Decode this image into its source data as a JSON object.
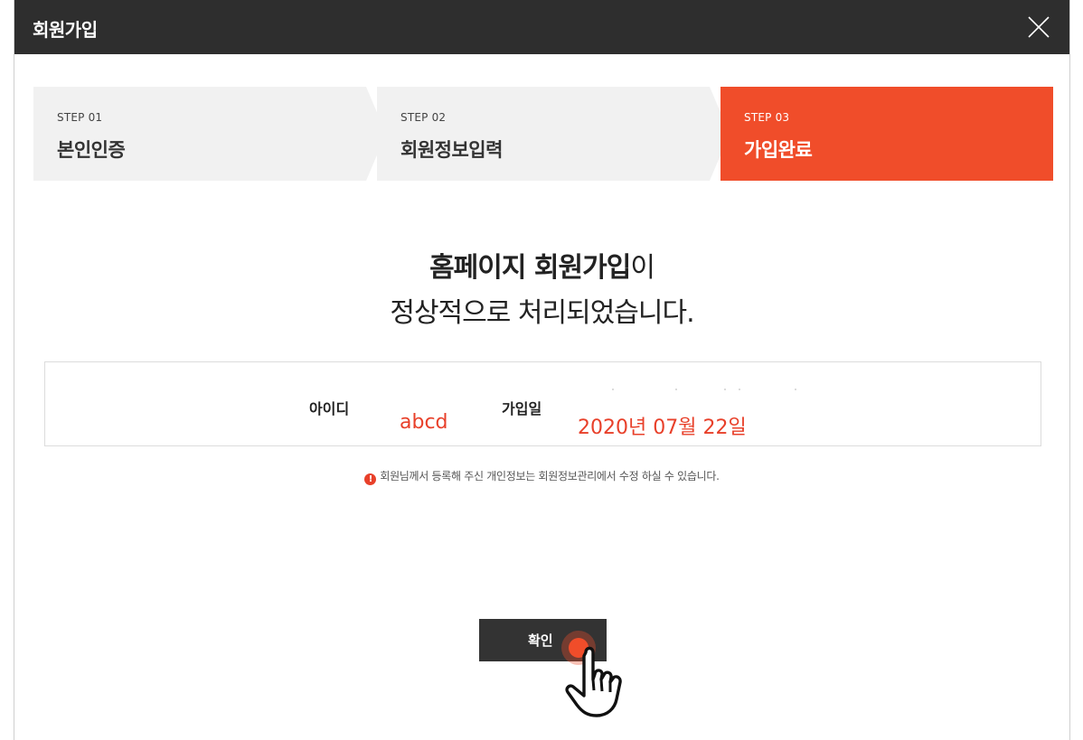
{
  "window": {
    "title": "회원가입"
  },
  "steps": [
    {
      "num": "STEP 01",
      "label": "본인인증"
    },
    {
      "num": "STEP 02",
      "label": "회원정보입력"
    },
    {
      "num": "STEP 03",
      "label": "가입완료"
    }
  ],
  "headline": {
    "line1_bold": "홈페이지 회원가입",
    "line1_rest": "이",
    "line2": "정상적으로 처리되었습니다."
  },
  "info": {
    "id_label": "아이디",
    "id_value": "abcd",
    "date_label": "가입일",
    "date_value": "2020년 07월 22일"
  },
  "notice": {
    "icon": "!",
    "text": "회원님께서 등록해 주신 개인정보는 회원정보관리에서 수정 하실 수 있습니다."
  },
  "confirm_label": "확인",
  "colors": {
    "accent": "#f04d2a",
    "dark": "#2e2e2e",
    "value_red": "#e8402a"
  }
}
